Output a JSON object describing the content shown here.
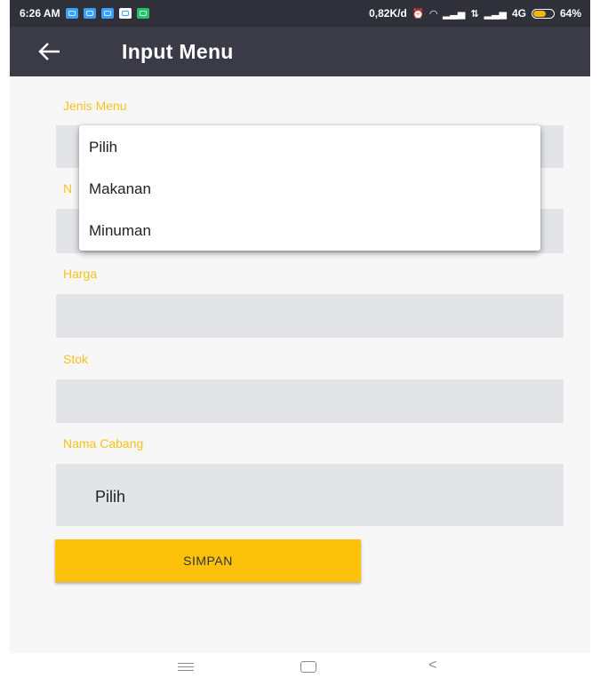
{
  "status_bar": {
    "time": "6:26 AM",
    "speed": "0,82K/d",
    "network": "4G",
    "battery": "64%",
    "battery_level": 0.64
  },
  "app_bar": {
    "title": "Input Menu",
    "back_icon": "arrow-left-icon"
  },
  "form": {
    "jenis_menu_label": "Jenis Menu",
    "nama_menu_label_partial": "N",
    "harga_label": "Harga",
    "stok_label": "Stok",
    "nama_cabang_label": "Nama Cabang",
    "nama_cabang_value": "Pilih",
    "submit_label": "SIMPAN"
  },
  "dropdown": {
    "options": [
      "Pilih",
      "Makanan",
      "Minuman"
    ]
  },
  "nav_bar": {
    "icons": [
      "menu-icon",
      "home-icon",
      "back-icon"
    ],
    "back_glyph": "<"
  },
  "colors": {
    "accent": "#fcc10b",
    "label": "#f6c21d",
    "app_bar": "#3a3b47",
    "field_bg": "#e2e4e8"
  }
}
